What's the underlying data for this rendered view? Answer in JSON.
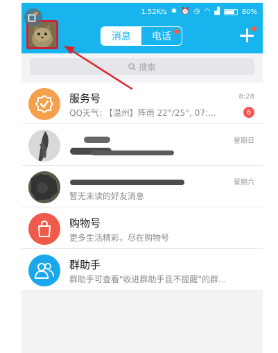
{
  "status_bar": {
    "speed": "1.52K/s",
    "battery": "80%",
    "battery_level": 0.8
  },
  "header": {
    "tabs": [
      {
        "label": "消息",
        "active": true
      },
      {
        "label": "电话",
        "active": false
      }
    ]
  },
  "search": {
    "placeholder": "搜索"
  },
  "conversations": [
    {
      "title": "服务号",
      "subtitle": "QQ天气: 【温州】阵雨 22°/25°, 07:...",
      "time": "8:28",
      "unread": "6"
    },
    {
      "title": "",
      "subtitle": "",
      "time": "星期日",
      "unread": ""
    },
    {
      "title": "",
      "subtitle": "暂无未读的好友消息",
      "time": "星期六",
      "unread": ""
    },
    {
      "title": "购物号",
      "subtitle": "更多生活精彩，尽在购物号",
      "time": "",
      "unread": ""
    },
    {
      "title": "群助手",
      "subtitle": "群助手可查看\"收进群助手且不提醒\"的群...",
      "time": "",
      "unread": ""
    }
  ],
  "colors": {
    "header": "#18b4ed",
    "service_icon": "#f6a04b",
    "shopping_icon": "#ef5a4a",
    "group_icon": "#1aa7ec",
    "annotation": "#d8262d",
    "badge": "#f55452"
  },
  "icons": [
    "signal-icon",
    "wifi-icon",
    "alarm-icon",
    "bluetooth-icon",
    "battery-icon",
    "search-icon",
    "plus-icon",
    "shield-check-icon",
    "shopping-bag-icon",
    "group-people-icon",
    "add-window-icon"
  ]
}
